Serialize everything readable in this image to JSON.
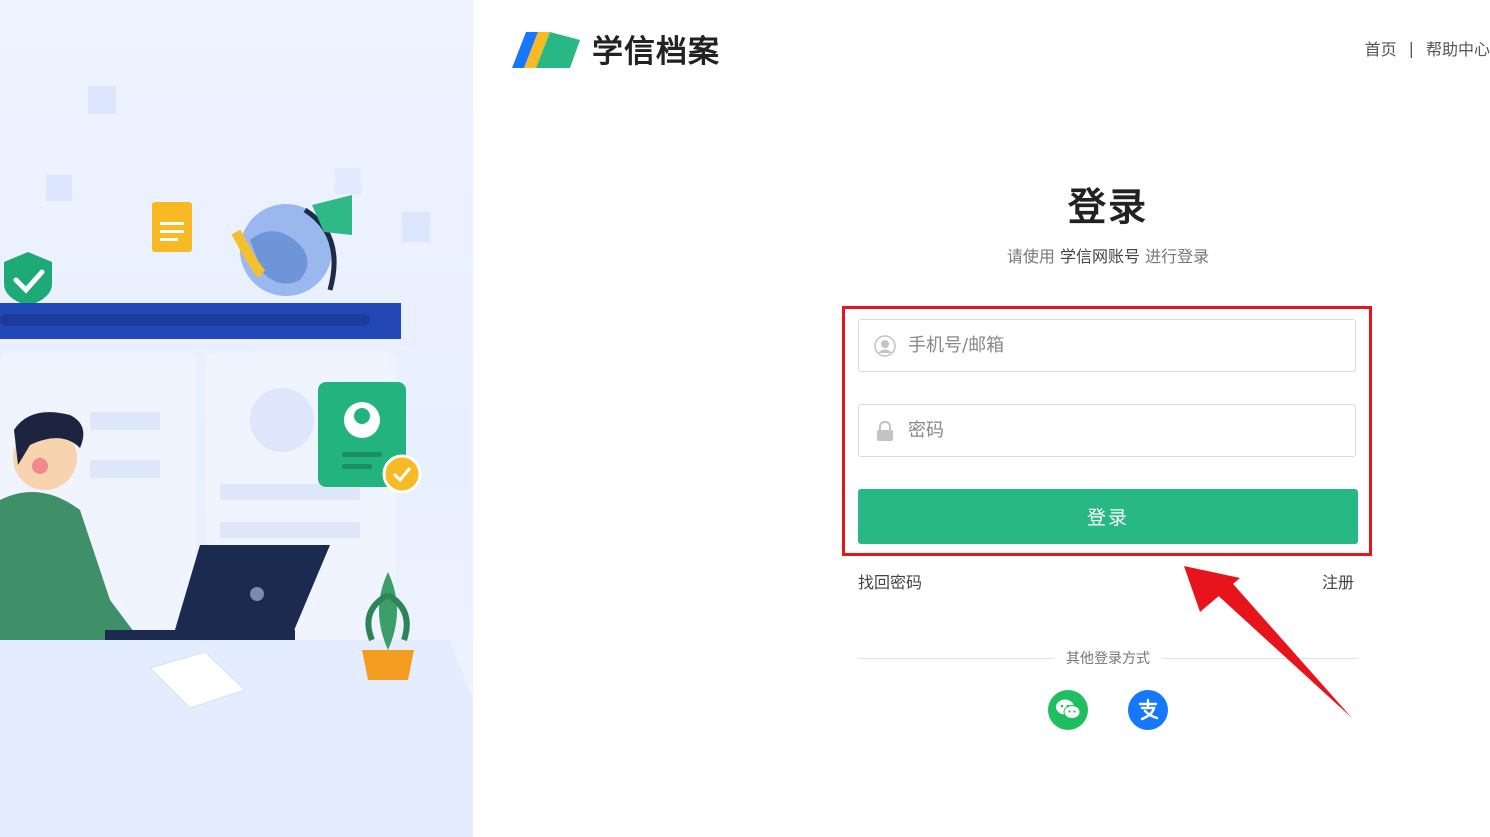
{
  "header": {
    "logo_text": "学信档案",
    "links": [
      "首页",
      "帮助中心"
    ],
    "separator": "|"
  },
  "login": {
    "title": "登录",
    "subtitle_prefix": "请使用",
    "subtitle_account": "学信网账号",
    "subtitle_suffix": "进行登录",
    "username_placeholder": "手机号/邮箱",
    "password_placeholder": "密码",
    "submit_label": "登录",
    "forgot_label": "找回密码",
    "register_label": "注册",
    "other_methods_label": "其他登录方式",
    "other_methods": [
      {
        "name": "wechat",
        "icon": "wechat-icon"
      },
      {
        "name": "alipay",
        "icon": "alipay-icon"
      }
    ]
  },
  "colors": {
    "primary_green": "#27b886",
    "highlight_red": "#e8141c",
    "wechat_green": "#1fbf5f",
    "alipay_blue": "#1677ff"
  }
}
